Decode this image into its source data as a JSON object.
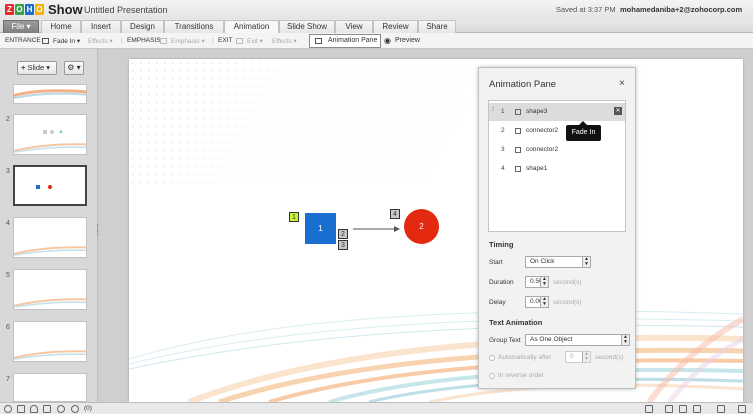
{
  "app": {
    "logo_letters": [
      "Z",
      "O",
      "H",
      "O"
    ],
    "logo_colors": [
      "#e22d28",
      "#3aa14a",
      "#1c6ec7",
      "#f2b10b"
    ],
    "product": "Show",
    "document_title": "Untitled Presentation",
    "saved_status": "Saved at 3:37 PM",
    "user_email": "mohamedaniba+2@zohocorp.com"
  },
  "tabs": [
    {
      "label": "File ▾"
    },
    {
      "label": "Home"
    },
    {
      "label": "Insert"
    },
    {
      "label": "Design"
    },
    {
      "label": "Transitions"
    },
    {
      "label": "Animation",
      "active": true
    },
    {
      "label": "Slide Show"
    },
    {
      "label": "View"
    },
    {
      "label": "Review"
    },
    {
      "label": "Share"
    }
  ],
  "ribbon": {
    "entrance_label": "ENTRANCE",
    "entrance_value": "Fade In ▾",
    "effects1": "Effects ▾",
    "emphasis_label": "EMPHASIS",
    "emphasis_value": "Emphasis ▾",
    "exit_label": "EXIT",
    "exit_value": "Exit ▾",
    "effects2": "Effects ▾",
    "animation_pane": "Animation Pane",
    "preview": "Preview"
  },
  "slides_panel": {
    "add_slide": "Slide ▾",
    "gear": "⚙ ▾",
    "slide_numbers": [
      "2",
      "3",
      "4",
      "5",
      "6",
      "7"
    ]
  },
  "slide": {
    "shape1_text": "1",
    "shape2_text": "2",
    "tags": [
      "1",
      "2",
      "3",
      "4"
    ]
  },
  "animation_pane": {
    "title": "Animation Pane",
    "close": "×",
    "items": [
      {
        "num": "1",
        "name": "shape3"
      },
      {
        "num": "2",
        "name": "connector2"
      },
      {
        "num": "3",
        "name": "connector2"
      },
      {
        "num": "4",
        "name": "shape1"
      }
    ],
    "tooltip": "Fade In",
    "timing": {
      "title": "Timing",
      "start_label": "Start",
      "start_value": "On Click",
      "duration_label": "Duration",
      "duration_value": "0.50",
      "delay_label": "Delay",
      "delay_value": "0.00",
      "unit": "second(s)"
    },
    "text_animation": {
      "title": "Text Animation",
      "group_text_label": "Group Text",
      "group_text_value": "As One Object",
      "automatically_after": "Automatically after",
      "auto_value": "0",
      "auto_unit": "second(s)",
      "reverse_order": "In reverse order"
    }
  },
  "statusbar": {
    "count": "(0)"
  },
  "colors": {
    "shape1": "#1a6fd0",
    "shape2": "#e3290f",
    "tag_first": "#c6f23a"
  }
}
